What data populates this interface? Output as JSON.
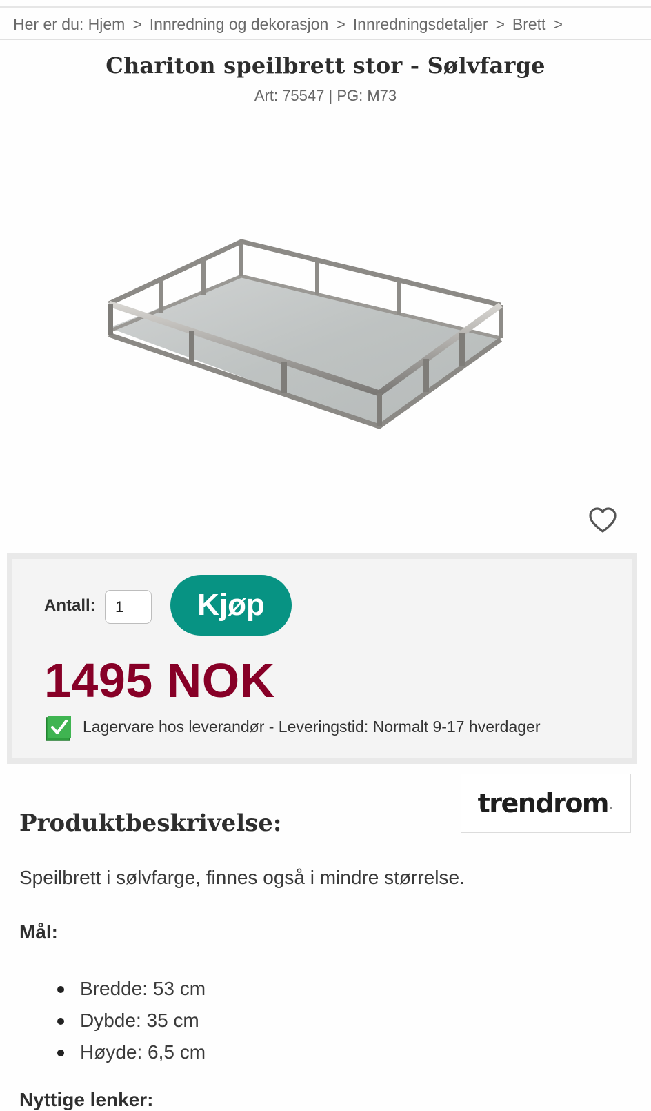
{
  "breadcrumb": {
    "prefix": "Her er du:",
    "items": [
      "Hjem",
      "Innredning og dekorasjon",
      "Innredningsdetaljer",
      "Brett"
    ],
    "separator": ">"
  },
  "product": {
    "title": "Chariton speilbrett stor - Sølvfarge",
    "art_line": "Art: 75547 | PG: M73",
    "image_alt": "speilbrett"
  },
  "favorite": {
    "icon": "heart-outline-icon"
  },
  "buy": {
    "qty_label": "Antall:",
    "qty_value": "1",
    "button_label": "Kjøp",
    "price": "1495 NOK",
    "stock_text": "Lagervare hos leverandør - Leveringstid: Normalt 9-17 hverdager",
    "stock_icon": "checkbox-checked-icon"
  },
  "brand": {
    "name": "trendrom",
    "dot": "."
  },
  "description": {
    "heading": "Produktbeskrivelse:",
    "text": "Speilbrett i sølvfarge, finnes også i mindre størrelse.",
    "dimensions_label": "Mål:",
    "dimensions": [
      "Bredde: 53 cm",
      "Dybde: 35 cm",
      "Høyde: 6,5 cm"
    ],
    "links_heading": "Nyttige lenker:"
  },
  "colors": {
    "buy_button": "#079383",
    "price": "#870027",
    "stock_check": "#2e9e3e"
  }
}
